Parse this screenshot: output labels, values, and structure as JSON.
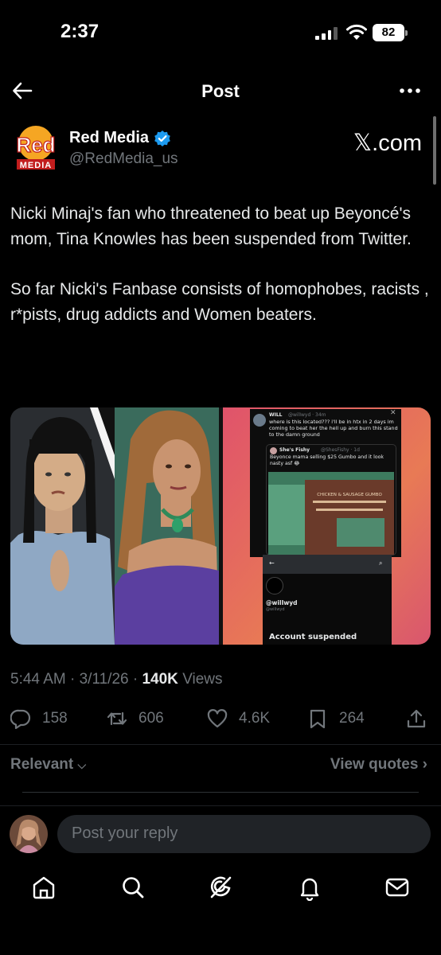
{
  "status_bar": {
    "time": "2:37",
    "battery": "82"
  },
  "header": {
    "title": "Post"
  },
  "author": {
    "name": "Red Media",
    "handle": "@RedMedia_us",
    "source_label": "𝕏.com",
    "logo_text_top": "Red",
    "logo_text_bottom": "MEDIA"
  },
  "tweet": {
    "paragraphs": [
      "Nicki Minaj's fan who threatened to beat up Beyoncé's mom, Tina Knowles has been suspended from Twitter.",
      "So far Nicki's Fanbase consists of homophobes, racists , r*pists, drug addicts and Women beaters."
    ]
  },
  "embedded_screenshot": {
    "top_name": "WILL",
    "top_handle": "@wilIwyd · 34m",
    "top_text": "where is this located??? i'll be in htx in 2 days im coming to beat her the hell up and burn this stand to the damn ground",
    "quoted_name": "She's Fishy",
    "quoted_handle": "@ShesFishy · 1d",
    "quoted_text": "Beyonce mama selling $25 Gumbo and it look nasty asf 😂",
    "sign_text": "CHICKEN & SAUSAGE GUMBO",
    "suspended_handle": "@wilIwyd",
    "suspended_handle_small": "@wilIwyd",
    "suspended_label": "Account suspended"
  },
  "meta": {
    "time": "5:44 AM",
    "sep1": "·",
    "date": "3/11/26",
    "sep2": "·",
    "views_count": "140K",
    "views_label": "Views"
  },
  "actions": {
    "replies": "158",
    "reposts": "606",
    "likes": "4.6K",
    "bookmarks": "264"
  },
  "filters": {
    "sort": "Relevant",
    "quotes": "View quotes"
  },
  "reply": {
    "placeholder": "Post your reply"
  },
  "colors": {
    "accent": "#1d9bf0",
    "verified": "#1d9bf0",
    "muted": "#71767b",
    "background": "#000000"
  },
  "icons": [
    "back-arrow-icon",
    "more-icon",
    "verified-badge-icon",
    "reply-icon",
    "repost-icon",
    "like-icon",
    "bookmark-icon",
    "share-icon",
    "home-icon",
    "search-icon",
    "grok-icon",
    "notifications-icon",
    "messages-icon"
  ]
}
